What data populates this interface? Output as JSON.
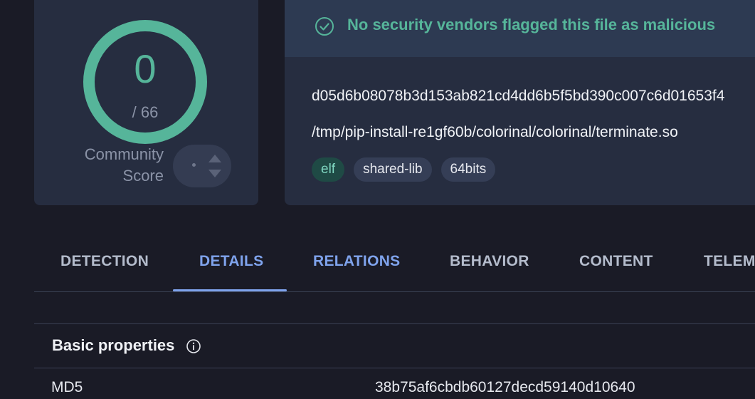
{
  "score": {
    "detections": "0",
    "total": "/ 66",
    "community_label_line1": "Community",
    "community_label_line2": "Score",
    "ring_color": "#56b59a"
  },
  "file": {
    "status_message": "No security vendors flagged this file as malicious",
    "status_icon": "check-circle-icon",
    "sha256": "d05d6b08078b3d153ab821cd4dd6b5f5bd390c007c6d01653f4",
    "path": "/tmp/pip-install-re1gf60b/colorinal/colorinal/terminate.so",
    "tags": [
      "elf",
      "shared-lib",
      "64bits"
    ]
  },
  "tabs": {
    "detection": "DETECTION",
    "details": "DETAILS",
    "relations": "RELATIONS",
    "behavior": "BEHAVIOR",
    "content": "CONTENT",
    "telemetry": "TELEM",
    "active": "DETAILS"
  },
  "basic_properties": {
    "title": "Basic properties",
    "rows": [
      {
        "key": "MD5",
        "value": "38b75af6cbdb60127decd59140d10640"
      }
    ]
  },
  "colors": {
    "background": "#1a1b26",
    "card": "#262d40",
    "accent_green": "#56b59a",
    "accent_blue": "#7fa3ec"
  }
}
